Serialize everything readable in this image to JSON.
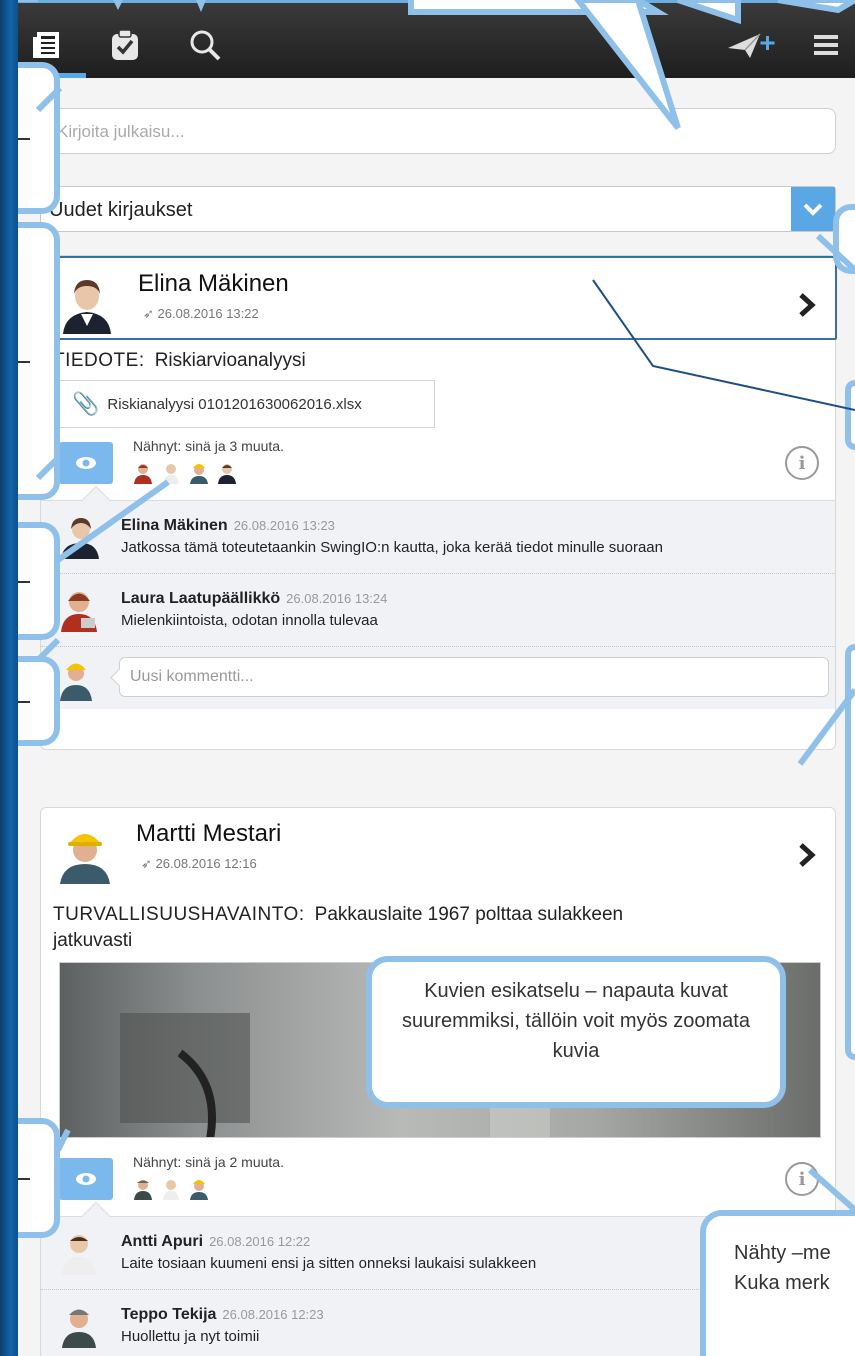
{
  "toolbar": {
    "icons": [
      "feed-icon",
      "tasks-icon",
      "search-icon",
      "new-post-icon",
      "menu-icon"
    ]
  },
  "compose": {
    "placeholder": "Kirjoita julkaisu..."
  },
  "filter": {
    "selected": "Uudet kirjaukset"
  },
  "posts": [
    {
      "author": "Elina Mäkinen",
      "timestamp": "26.08.2016 13:22",
      "category": "TIEDOTE",
      "text": "Riskiarvioanalyysi",
      "attachment": "Riskianalyysi 0101201630062016.xlsx",
      "seen": "Nähnyt: sinä ja 3 muuta.",
      "comments": [
        {
          "name": "Elina Mäkinen",
          "ts": "26.08.2016 13:23",
          "text": "Jatkossa tämä toteutetaankin SwingIO:n kautta, joka kerää tiedot minulle suoraan"
        },
        {
          "name": "Laura Laatupäällikkö",
          "ts": "26.08.2016 13:24",
          "text": "Mielenkiintoista, odotan innolla tulevaa"
        }
      ],
      "new_comment_placeholder": "Uusi kommentti..."
    },
    {
      "author": "Martti Mestari",
      "timestamp": "26.08.2016 12:16",
      "category": "TURVALLISUUSHAVAINTO",
      "text": "Pakkauslaite 1967 polttaa sulakkeen jatkuvasti",
      "seen": "Nähnyt: sinä ja 2 muuta.",
      "comments": [
        {
          "name": "Antti Apuri",
          "ts": "26.08.2016 12:22",
          "text": "Laite tosiaan kuumeni ensi ja sitten onneksi laukaisi sulakkeen"
        },
        {
          "name": "Teppo Tekija",
          "ts": "26.08.2016 12:23",
          "text": "Huollettu ja nyt toimii"
        }
      ]
    }
  ],
  "callouts": {
    "image_preview": "Kuvien esikatselu – napauta kuvat suuremmiksi, tällöin voit myös zoomata kuvia",
    "seen_info": "Nähty –me\nKuka merk"
  },
  "colors": {
    "accent": "#5aa7e6",
    "callout_border": "#8fc0ea",
    "topbar": "#2a2a2a"
  }
}
